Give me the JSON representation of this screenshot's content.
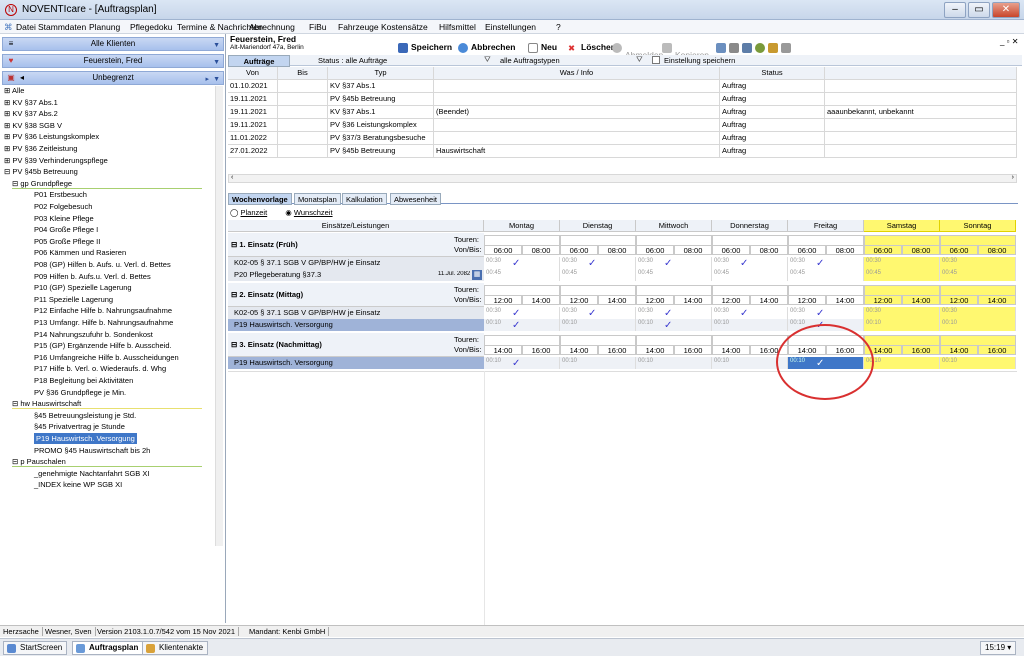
{
  "window": {
    "title": "NOVENTIcare - [Auftragsplan]"
  },
  "menu": [
    "Datei",
    "Stammdaten",
    "Planung",
    "Pflegedoku",
    "Termine & Nachrichten",
    "Abrechnung",
    "FiBu",
    "Fahrzeuge",
    "Kostensätze",
    "Hilfsmittel",
    "Einstellungen",
    "?"
  ],
  "left": {
    "client_filter": "Alle Klienten",
    "patient_select": "Feuerstein, Fred",
    "period_select": "Unbegrenzt"
  },
  "tree": [
    {
      "l": 0,
      "t": "⊞ Alle"
    },
    {
      "l": 0,
      "t": "⊞ KV §37 Abs.1"
    },
    {
      "l": 0,
      "t": "⊞ KV §37 Abs.2"
    },
    {
      "l": 0,
      "t": "⊞ KV §38 SGB V"
    },
    {
      "l": 0,
      "t": "⊞ PV §36 Leistungskomplex"
    },
    {
      "l": 0,
      "t": "⊞ PV §36 Zeitleistung"
    },
    {
      "l": 0,
      "t": "⊞ PV §39 Verhinderungspflege"
    },
    {
      "l": 0,
      "t": "⊟ PV §45b Betreuung"
    },
    {
      "l": 1,
      "t": "⊟ gp   Grundpflege"
    },
    {
      "l": 2,
      "t": "P01 Erstbesuch"
    },
    {
      "l": 2,
      "t": "P02 Folgebesuch"
    },
    {
      "l": 2,
      "t": "P03 Kleine Pflege"
    },
    {
      "l": 2,
      "t": "P04 Große Pflege I"
    },
    {
      "l": 2,
      "t": "P05 Große Pflege II"
    },
    {
      "l": 2,
      "t": "P06 Kämmen und Rasieren"
    },
    {
      "l": 2,
      "t": "P08 (GP) Hilfen b. Aufs. u. Verl. d. Bettes"
    },
    {
      "l": 2,
      "t": "P09 Hilfen b. Aufs.u. Verl. d. Bettes"
    },
    {
      "l": 2,
      "t": "P10 (GP) Spezielle Lagerung"
    },
    {
      "l": 2,
      "t": "P11 Spezielle Lagerung"
    },
    {
      "l": 2,
      "t": "P12 Einfache Hilfe b. Nahrungsaufnahme"
    },
    {
      "l": 2,
      "t": "P13 Umfangr. Hilfe b. Nahrungsaufnahme"
    },
    {
      "l": 2,
      "t": "P14 Nahrungszufuhr b. Sondenkost"
    },
    {
      "l": 2,
      "t": "P15 (GP) Ergänzende Hilfe b. Ausscheid."
    },
    {
      "l": 2,
      "t": "P16 Umfangreiche Hilfe b. Ausscheidungen"
    },
    {
      "l": 2,
      "t": "P17 Hilfe b. Verl. o. Wiederaufs. d. Whg"
    },
    {
      "l": 2,
      "t": "P18 Begleitung bei Aktivitäten"
    },
    {
      "l": 2,
      "t": "PV §36 Grundpflege je Min."
    },
    {
      "l": 1,
      "t": "⊟ hw   Hauswirtschaft"
    },
    {
      "l": 2,
      "t": "§45 Betreuungsleistung je Std."
    },
    {
      "l": 2,
      "t": "§45 Privatvertrag je Stunde"
    },
    {
      "l": 2,
      "t": "P19 Hauswirtsch. Versorgung",
      "sel": true
    },
    {
      "l": 2,
      "t": "PROMO §45 Hauswirtschaft bis 2h"
    },
    {
      "l": 1,
      "t": "⊟ p    Pauschalen"
    },
    {
      "l": 2,
      "t": "_genehmigte Nachtanfahrt SGB XI"
    },
    {
      "l": 2,
      "t": "_INDEX keine WP SGB XI"
    }
  ],
  "patient": {
    "name": "Feuerstein, Fred",
    "address": "Alt-Mariendorf 47a, Berlin"
  },
  "toolbar": {
    "save": "Speichern",
    "cancel": "Abbrechen",
    "new": "Neu",
    "delete": "Löschen",
    "sign_off": "Abmelden",
    "copy": "Kopieren"
  },
  "orders": {
    "tab": "Aufträge",
    "status_label": "Status :  alle Aufträge",
    "type_filter": "alle Auftragstypen",
    "save_setting": "Einstellung speichern",
    "headers": [
      "Von",
      "Bis",
      "Typ",
      "Was / Info",
      "Status",
      ""
    ],
    "rows": [
      [
        "01.10.2021",
        "",
        "KV §37 Abs.1",
        "",
        "Auftrag",
        ""
      ],
      [
        "19.11.2021",
        "",
        "PV §45b Betreuung",
        "",
        "Auftrag",
        ""
      ],
      [
        "19.11.2021",
        "",
        "KV §37 Abs.1",
        "(Beendet)",
        "Auftrag",
        "aaaunbekannt, unbekannt"
      ],
      [
        "19.11.2021",
        "",
        "PV §36 Leistungskomplex",
        "",
        "Auftrag",
        ""
      ],
      [
        "11.01.2022",
        "",
        "PV §37/3 Beratungsbesuche",
        "",
        "Auftrag",
        ""
      ],
      [
        "27.01.2022",
        "",
        "PV §45b Betreuung",
        "Hauswirtschaft",
        "Auftrag",
        ""
      ]
    ]
  },
  "sub_tabs": [
    "Wochenvorlage",
    "Monatsplan",
    "Kalkulation",
    "Abwesenheit"
  ],
  "radio": {
    "plan": "Planzeit",
    "wish": "Wunschzeit"
  },
  "week": {
    "header_first": "Einsätze/Leistungen",
    "days": [
      "Montag",
      "Dienstag",
      "Mittwoch",
      "Donnerstag",
      "Freitag",
      "Samstag",
      "Sonntag"
    ],
    "tours_label": "Touren:",
    "vonbis_label": "Von/Bis:",
    "blocks": [
      {
        "title": "⊟ 1. Einsatz (Früh)",
        "from": "06:00",
        "to": "08:00",
        "items": [
          {
            "name": "K02-05 § 37.1 SGB V GP/BP/HW je Einsatz",
            "kval": "00:30",
            "checks": [
              1,
              1,
              1,
              1,
              1,
              0,
              0
            ]
          },
          {
            "name": "P20 Pflegeberatung §37.3",
            "date": "11.Jul. 2082",
            "kval": "00:45",
            "checks": [
              0,
              0,
              0,
              0,
              0,
              0,
              0
            ]
          }
        ]
      },
      {
        "title": "⊟ 2. Einsatz (Mittag)",
        "from": "12:00",
        "to": "14:00",
        "items": [
          {
            "name": "K02-05 § 37.1 SGB V GP/BP/HW je Einsatz",
            "kval": "00:30",
            "checks": [
              1,
              1,
              1,
              1,
              1,
              0,
              0
            ]
          },
          {
            "name": "P19 Hauswirtsch. Versorgung",
            "kval": "00:10",
            "checks": [
              1,
              0,
              1,
              0,
              1,
              0,
              0
            ],
            "hl": true
          }
        ]
      },
      {
        "title": "⊟ 3. Einsatz (Nachmittag)",
        "from": "14:00",
        "to": "16:00",
        "items": [
          {
            "name": "P19 Hauswirtsch. Versorgung",
            "kval": "00:10",
            "checks": [
              1,
              0,
              0,
              0,
              1,
              0,
              0
            ],
            "hl": true,
            "selday": 4
          }
        ]
      }
    ]
  },
  "status": {
    "user_label": "Herzsache",
    "user": "Wesner, Sven",
    "version": "Version 2103.1.0.7/542  vom 15 Nov 2021",
    "client": "Mandant: Kenbi GmbH"
  },
  "taskbar": {
    "items": [
      "StartScreen",
      "Auftragsplan",
      "Klientenakte"
    ],
    "clock": "15:19"
  },
  "colors": {
    "accent": "#3f77c8",
    "weekend": "#fff870",
    "annotation": "#d93030"
  }
}
